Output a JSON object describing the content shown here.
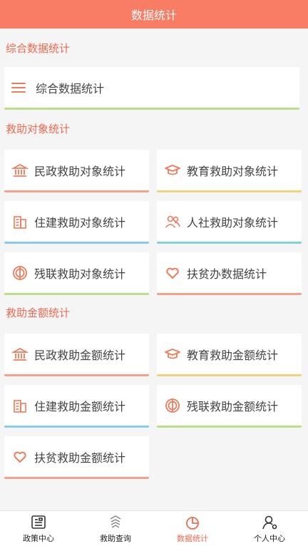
{
  "header": {
    "title": "数据统计"
  },
  "colors": {
    "accent": "#f97c64",
    "section_text": "#ef6a50"
  },
  "section1": {
    "title": "综合数据统计",
    "card": {
      "label": "综合数据统计",
      "icon": "menu-icon"
    }
  },
  "section2": {
    "title": "救助对象统计",
    "cards": [
      {
        "label": "民政救助对象统计",
        "icon": "bank-icon"
      },
      {
        "label": "教育救助对象统计",
        "icon": "graduation-cap-icon"
      },
      {
        "label": "住建救助对象统计",
        "icon": "building-icon"
      },
      {
        "label": "人社救助对象统计",
        "icon": "people-icon"
      },
      {
        "label": "残联救助对象统计",
        "icon": "disability-icon"
      },
      {
        "label": "扶贫办数据统计",
        "icon": "heart-icon"
      }
    ]
  },
  "section3": {
    "title": "救助金额统计",
    "cards": [
      {
        "label": "民政救助金额统计",
        "icon": "bank-icon"
      },
      {
        "label": "教育救助金额统计",
        "icon": "graduation-cap-icon"
      },
      {
        "label": "住建救助金额统计",
        "icon": "building-icon"
      },
      {
        "label": "残联救助金额统计",
        "icon": "disability-icon"
      },
      {
        "label": "扶贫救助金额统计",
        "icon": "heart-icon"
      }
    ]
  },
  "tabbar": {
    "active": "数据统计",
    "tabs": [
      {
        "label": "政策中心",
        "icon": "document-icon"
      },
      {
        "label": "救助查询",
        "icon": "search-icon"
      },
      {
        "label": "数据统计",
        "icon": "pie-chart-icon"
      },
      {
        "label": "个人中心",
        "icon": "user-icon"
      }
    ]
  }
}
